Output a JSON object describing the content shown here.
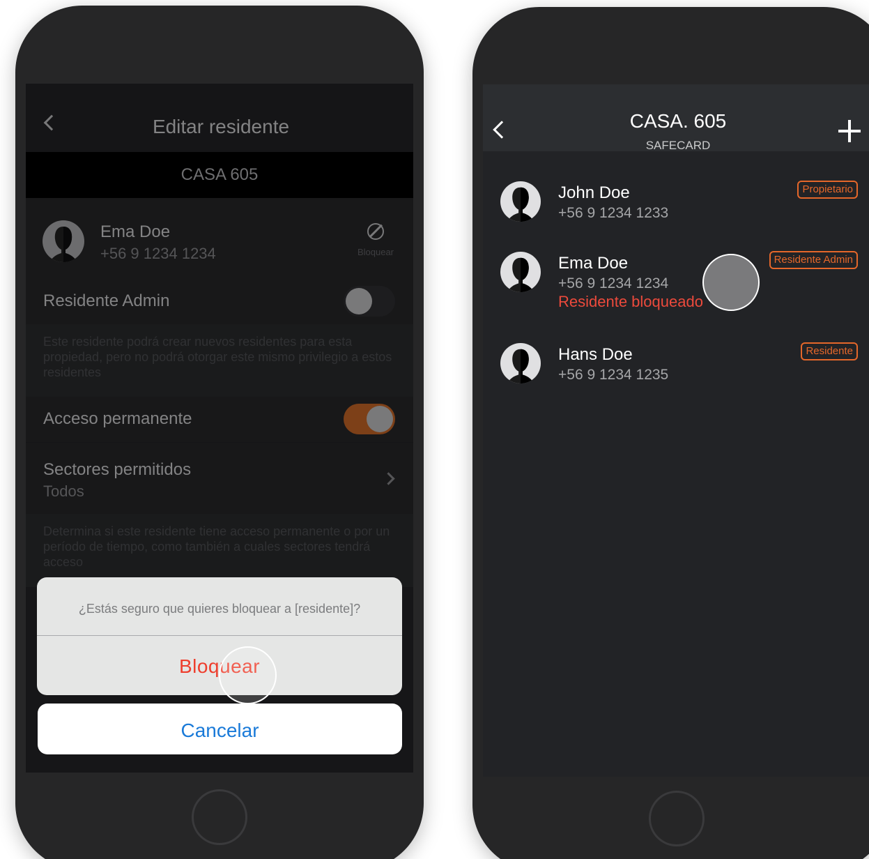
{
  "left_screen": {
    "header": {
      "title": "Editar residente"
    },
    "property_band": "CASA 605",
    "resident": {
      "name": "Ema Doe",
      "phone": "+56 9 1234 1234",
      "block_label": "Bloquear"
    },
    "admin_toggle": {
      "label": "Residente Admin",
      "state": "off"
    },
    "admin_description": "Este residente podrá crear nuevos residentes para esta propiedad, pero no podrá otorgar este mismo privilegio a estos residentes",
    "permanent_toggle": {
      "label": "Acceso permanente",
      "state": "on"
    },
    "sectors": {
      "label": "Sectores permitidos",
      "value": "Todos"
    },
    "sectors_description": "Determina si este residente tiene acceso permanente o por un período de tiempo, como también a cuales sectores tendrá acceso",
    "action_sheet": {
      "message": "¿Estás seguro que quieres bloquear a [residente]?",
      "action_label": "Bloquear",
      "cancel_label": "Cancelar"
    }
  },
  "right_screen": {
    "header": {
      "title": "CASA. 605",
      "subtitle": "SAFECARD"
    },
    "residents": [
      {
        "name": "John Doe",
        "phone": "+56 9 1234 1233",
        "role": "Propietario",
        "status": ""
      },
      {
        "name": "Ema Doe",
        "phone": "+56 9 1234 1234",
        "role": "Residente Admin",
        "status": "Residente bloqueado"
      },
      {
        "name": "Hans Doe",
        "phone": "+56 9 1234 1235",
        "role": "Residente",
        "status": ""
      }
    ]
  },
  "colors": {
    "accent_orange": "#e5672a",
    "destructive_red": "#ee3e2d",
    "blocked_red": "#ec4a3c",
    "cancel_blue": "#1a7ad8",
    "toggle_on": "#a0521f"
  },
  "icons": [
    "back-chevron-icon",
    "block-icon",
    "chevron-right-icon",
    "plus-icon",
    "avatar-silhouette-icon"
  ]
}
